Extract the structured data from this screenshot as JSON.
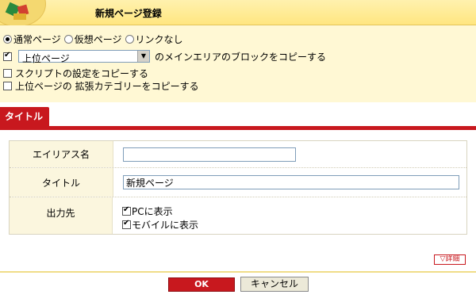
{
  "header": {
    "title": "新規ページ登録"
  },
  "options": {
    "page_types": [
      {
        "label": "通常ページ",
        "selected": true
      },
      {
        "label": "仮想ページ",
        "selected": false
      },
      {
        "label": "リンクなし",
        "selected": false
      }
    ],
    "copy_block": {
      "checked": true,
      "select_value": "上位ページ",
      "suffix": "のメインエリアのブロックをコピーする"
    },
    "copy_script": {
      "checked": false,
      "label": "スクリプトの設定をコピーする"
    },
    "copy_category": {
      "checked": false,
      "label": "上位ページの 拡張カテゴリーをコピーする"
    }
  },
  "tab": {
    "label": "タイトル"
  },
  "form": {
    "alias": {
      "label": "エイリアス名",
      "value": ""
    },
    "title": {
      "label": "タイトル",
      "value": "新規ページ"
    },
    "output": {
      "label": "出力先",
      "pc": {
        "label": "PCに表示",
        "checked": true
      },
      "mobile": {
        "label": "モバイルに表示",
        "checked": true
      }
    }
  },
  "detail_button": "▽詳細",
  "buttons": {
    "ok": "OK",
    "cancel": "キャンセル"
  },
  "colors": {
    "accent": "#c8181e",
    "header_bg": "#ffe680",
    "panel_bg": "#fff8d4"
  }
}
